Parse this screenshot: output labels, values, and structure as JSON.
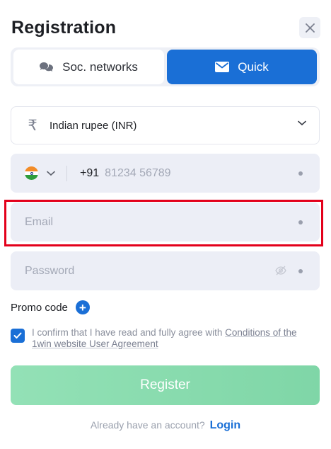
{
  "header": {
    "title": "Registration",
    "close_icon": "close-icon"
  },
  "tabs": [
    {
      "label": "Soc. networks",
      "icon": "chat-bubbles-icon",
      "active": false
    },
    {
      "label": "Quick",
      "icon": "envelope-icon",
      "active": true
    }
  ],
  "form": {
    "currency": {
      "icon": "rupee-icon",
      "value": "Indian rupee (INR)"
    },
    "phone": {
      "flag": "india-flag-icon",
      "code": "+91",
      "placeholder": "81234 56789"
    },
    "email": {
      "placeholder": "Email"
    },
    "password": {
      "placeholder": "Password",
      "icon": "eye-icon"
    },
    "promo_label": "Promo code",
    "consent": {
      "checked": true,
      "text": "I confirm that I have read and fully agree with",
      "link": "Conditions of the 1win website User Agreement"
    },
    "register_label": "Register"
  },
  "footer": {
    "prompt": "Already have an account?",
    "login_label": "Login"
  },
  "colors": {
    "accent": "#1a6fd6",
    "register_button": "#86dcab",
    "highlight": "#e3001b"
  }
}
